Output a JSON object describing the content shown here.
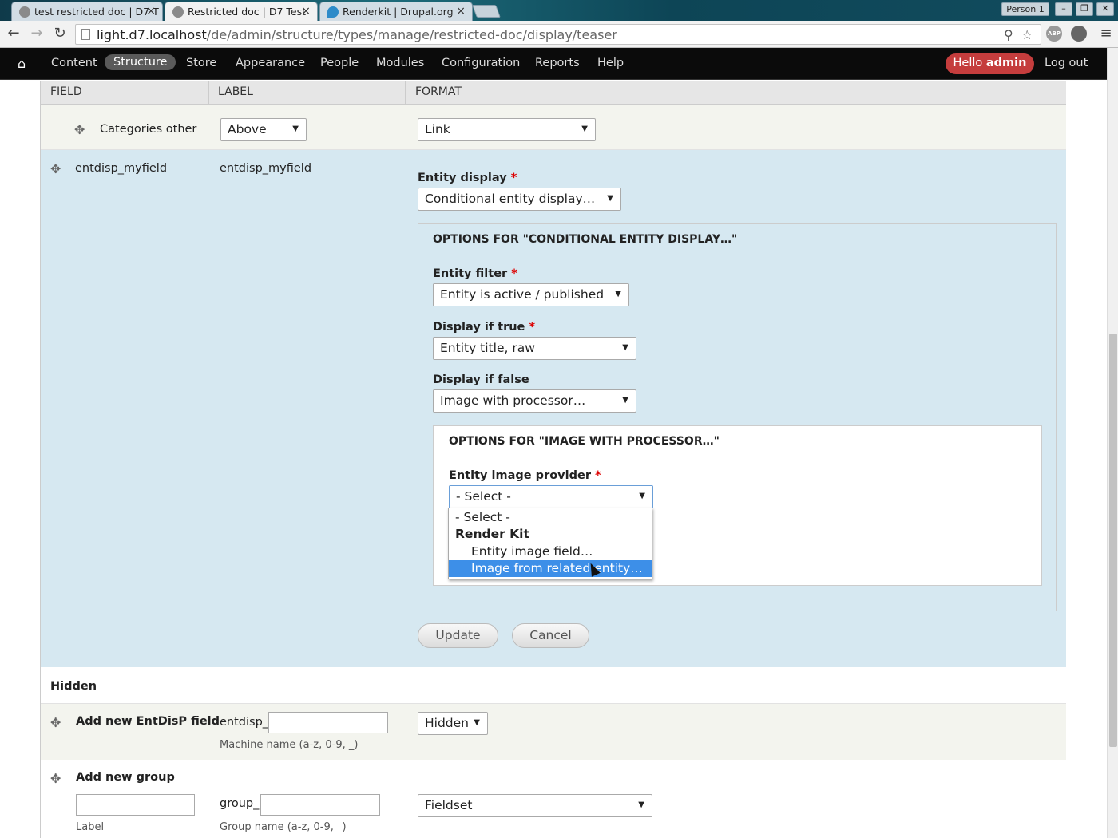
{
  "browser": {
    "tabs": [
      {
        "title": "test restricted doc | D7 T"
      },
      {
        "title": "Restricted doc | D7 Test"
      },
      {
        "title": "Renderkit | Drupal.org"
      }
    ],
    "close_glyph": "×",
    "profile": "Person 1",
    "url_host": "light.d7.localhost",
    "url_path": "/de/admin/structure/types/manage/restricted-doc/display/teaser",
    "extensions": [
      "ABP"
    ]
  },
  "admin_menu": {
    "items": [
      "Content",
      "Structure",
      "Store",
      "Appearance",
      "People",
      "Modules",
      "Configuration",
      "Reports",
      "Help"
    ],
    "active": "Structure",
    "hello": "Hello",
    "user": "admin",
    "logout": "Log out"
  },
  "table": {
    "headers": {
      "field": "FIELD",
      "label": "LABEL",
      "format": "FORMAT"
    },
    "row1": {
      "field": "Categories other",
      "label_select": "Above",
      "format_select": "Link"
    },
    "row2": {
      "field": "entdisp_myfield",
      "label": "entdisp_myfield",
      "entity_display_label": "Entity display",
      "entity_display_value": "Conditional entity display…",
      "options_title": "OPTIONS FOR \"CONDITIONAL ENTITY DISPLAY…\"",
      "entity_filter_label": "Entity filter",
      "entity_filter_value": "Entity is active / published",
      "display_true_label": "Display if true",
      "display_true_value": "Entity title, raw",
      "display_false_label": "Display if false",
      "display_false_value": "Image with processor…",
      "inner_title": "OPTIONS FOR \"IMAGE WITH PROCESSOR…\"",
      "provider_label": "Entity image provider",
      "provider_value": "- Select -",
      "required_marker": "*",
      "update": "Update",
      "cancel": "Cancel"
    },
    "dropdown_options": [
      {
        "text": "- Select -",
        "kind": "option"
      },
      {
        "text": "Render Kit",
        "kind": "group"
      },
      {
        "text": "Entity image field…",
        "kind": "sub"
      },
      {
        "text": "Image from related entity…",
        "kind": "sub",
        "highlighted": true
      }
    ],
    "hidden_label": "Hidden",
    "add_field": {
      "label": "Add new EntDisP field",
      "prefix": "entdisp_",
      "desc": "Machine name (a-z, 0-9, _)",
      "select": "Hidden"
    },
    "add_group": {
      "label": "Add new group",
      "label_desc": "Label",
      "prefix": "group_",
      "desc": "Group name (a-z, 0-9, _)",
      "select": "Fieldset"
    }
  },
  "colors": {
    "row_highlight": "#d6e8f1",
    "row_odd": "#f3f4ee",
    "hello_badge": "#c53d3d",
    "option_highlight": "#3d8fe8"
  }
}
